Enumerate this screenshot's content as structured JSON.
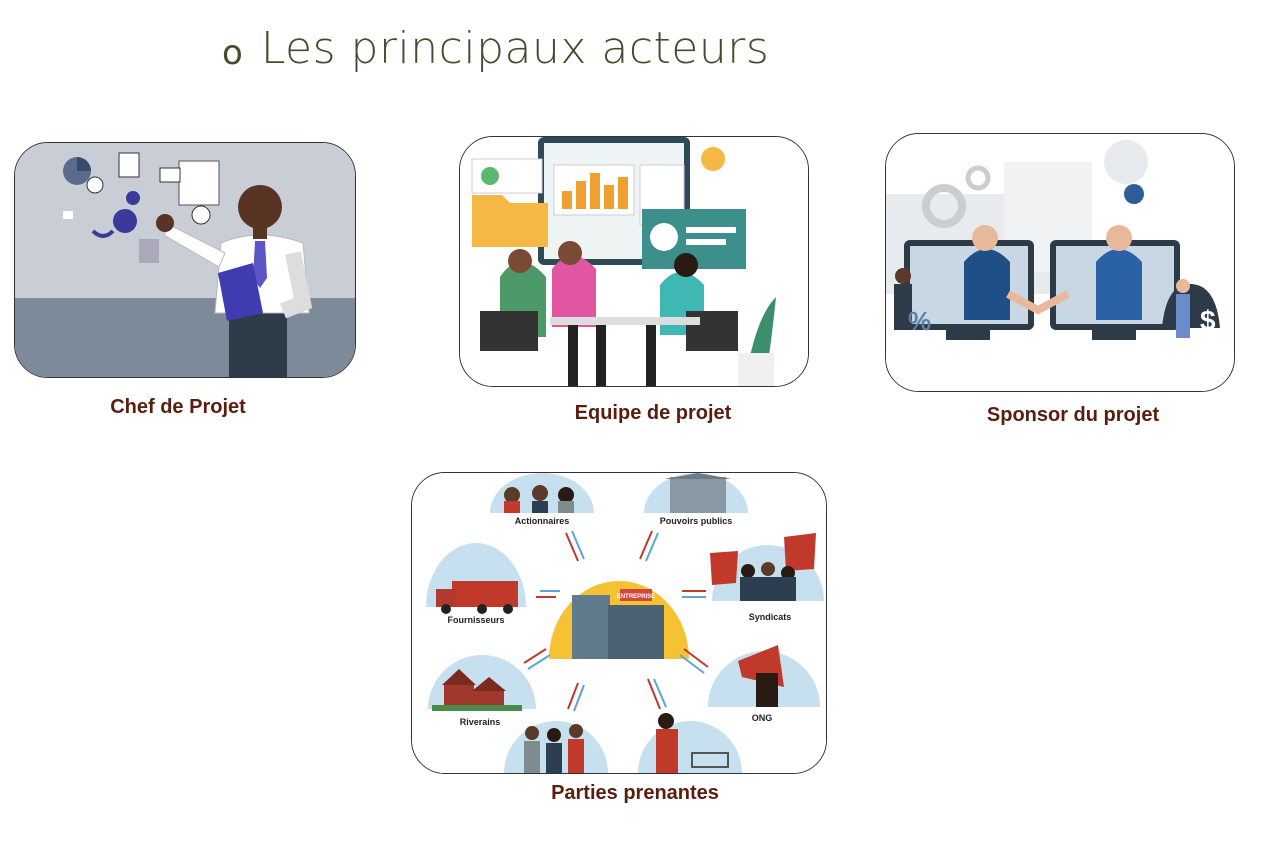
{
  "slide": {
    "bullet": "o",
    "title": "Les principaux acteurs"
  },
  "cards": {
    "chef": {
      "label": "Chef de Projet"
    },
    "equipe": {
      "label": "Equipe de projet"
    },
    "sponsor": {
      "label": "Sponsor du projet"
    },
    "parties": {
      "label": "Parties prenantes",
      "center_label": "ENTREPRISE",
      "stakeholders": [
        "Actionnaires",
        "Pouvoirs publics",
        "Syndicats",
        "ONG",
        "Riverains",
        "Fournisseurs"
      ]
    }
  }
}
